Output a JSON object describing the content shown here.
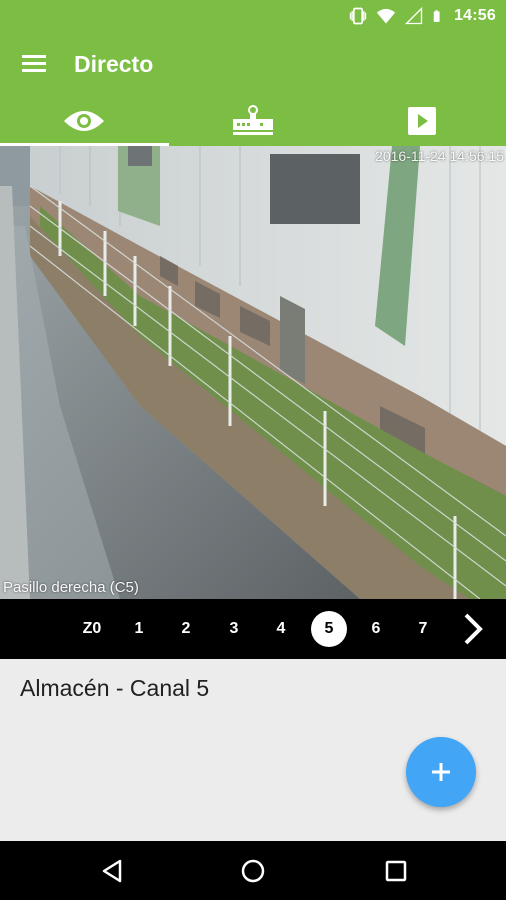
{
  "status_bar": {
    "time": "14:56"
  },
  "app_bar": {
    "title": "Directo",
    "menu_icon": "hamburger-menu-icon"
  },
  "tabs": [
    {
      "name": "live",
      "icon": "eye-icon",
      "active": true
    },
    {
      "name": "recorder",
      "icon": "dvr-icon",
      "active": false
    },
    {
      "name": "playback",
      "icon": "play-icon",
      "active": false
    }
  ],
  "camera": {
    "timestamp": "2016-11-24 14:56:15",
    "label": "Pasillo derecha (C5)"
  },
  "channels": {
    "items": [
      "Z0",
      "1",
      "2",
      "3",
      "4",
      "5",
      "6",
      "7"
    ],
    "selected": "5",
    "next_icon": "chevron-right-icon"
  },
  "content": {
    "location_title": "Almacén - Canal 5",
    "fab_icon": "add-icon"
  },
  "nav_bar": {
    "icons": [
      "back-icon",
      "home-icon",
      "recents-icon"
    ]
  },
  "colors": {
    "primary": "#7cbd43",
    "accent": "#42a5f5"
  }
}
